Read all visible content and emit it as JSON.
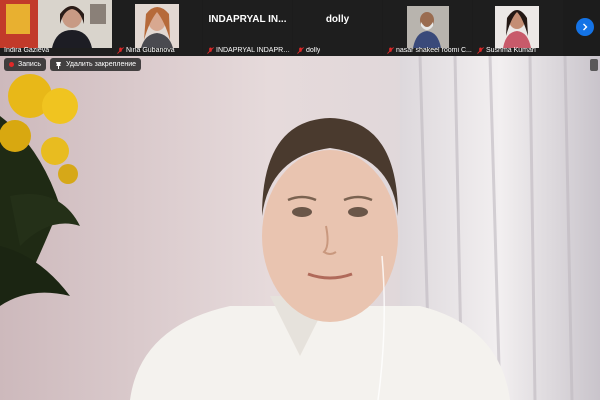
{
  "participants": [
    {
      "name": "Indira Gazieva",
      "muted": false,
      "has_video": true
    },
    {
      "name": "Nina Gubanova",
      "muted": true,
      "has_video": true
    },
    {
      "name": "INDAPRYAL INDAPRYAL",
      "display_name": "INDAPRYAL  IN...",
      "muted": true,
      "has_video": false
    },
    {
      "name": "dolly",
      "display_name": "dolly",
      "muted": true,
      "has_video": false
    },
    {
      "name": "nasar shakeel roomi C...",
      "muted": true,
      "has_video": true
    },
    {
      "name": "Sushma Kumari",
      "muted": true,
      "has_video": true
    }
  ],
  "toolbar": {
    "record_label": "Запись",
    "unpin_label": "Удалить закрепление"
  },
  "icons": {
    "next_page": "chevron-right-icon",
    "muted": "mic-muted-icon",
    "pin": "pin-icon",
    "record": "record-dot-icon"
  },
  "colors": {
    "accent": "#1473e6",
    "muted_red": "#e02828",
    "record_red": "#e02828"
  }
}
